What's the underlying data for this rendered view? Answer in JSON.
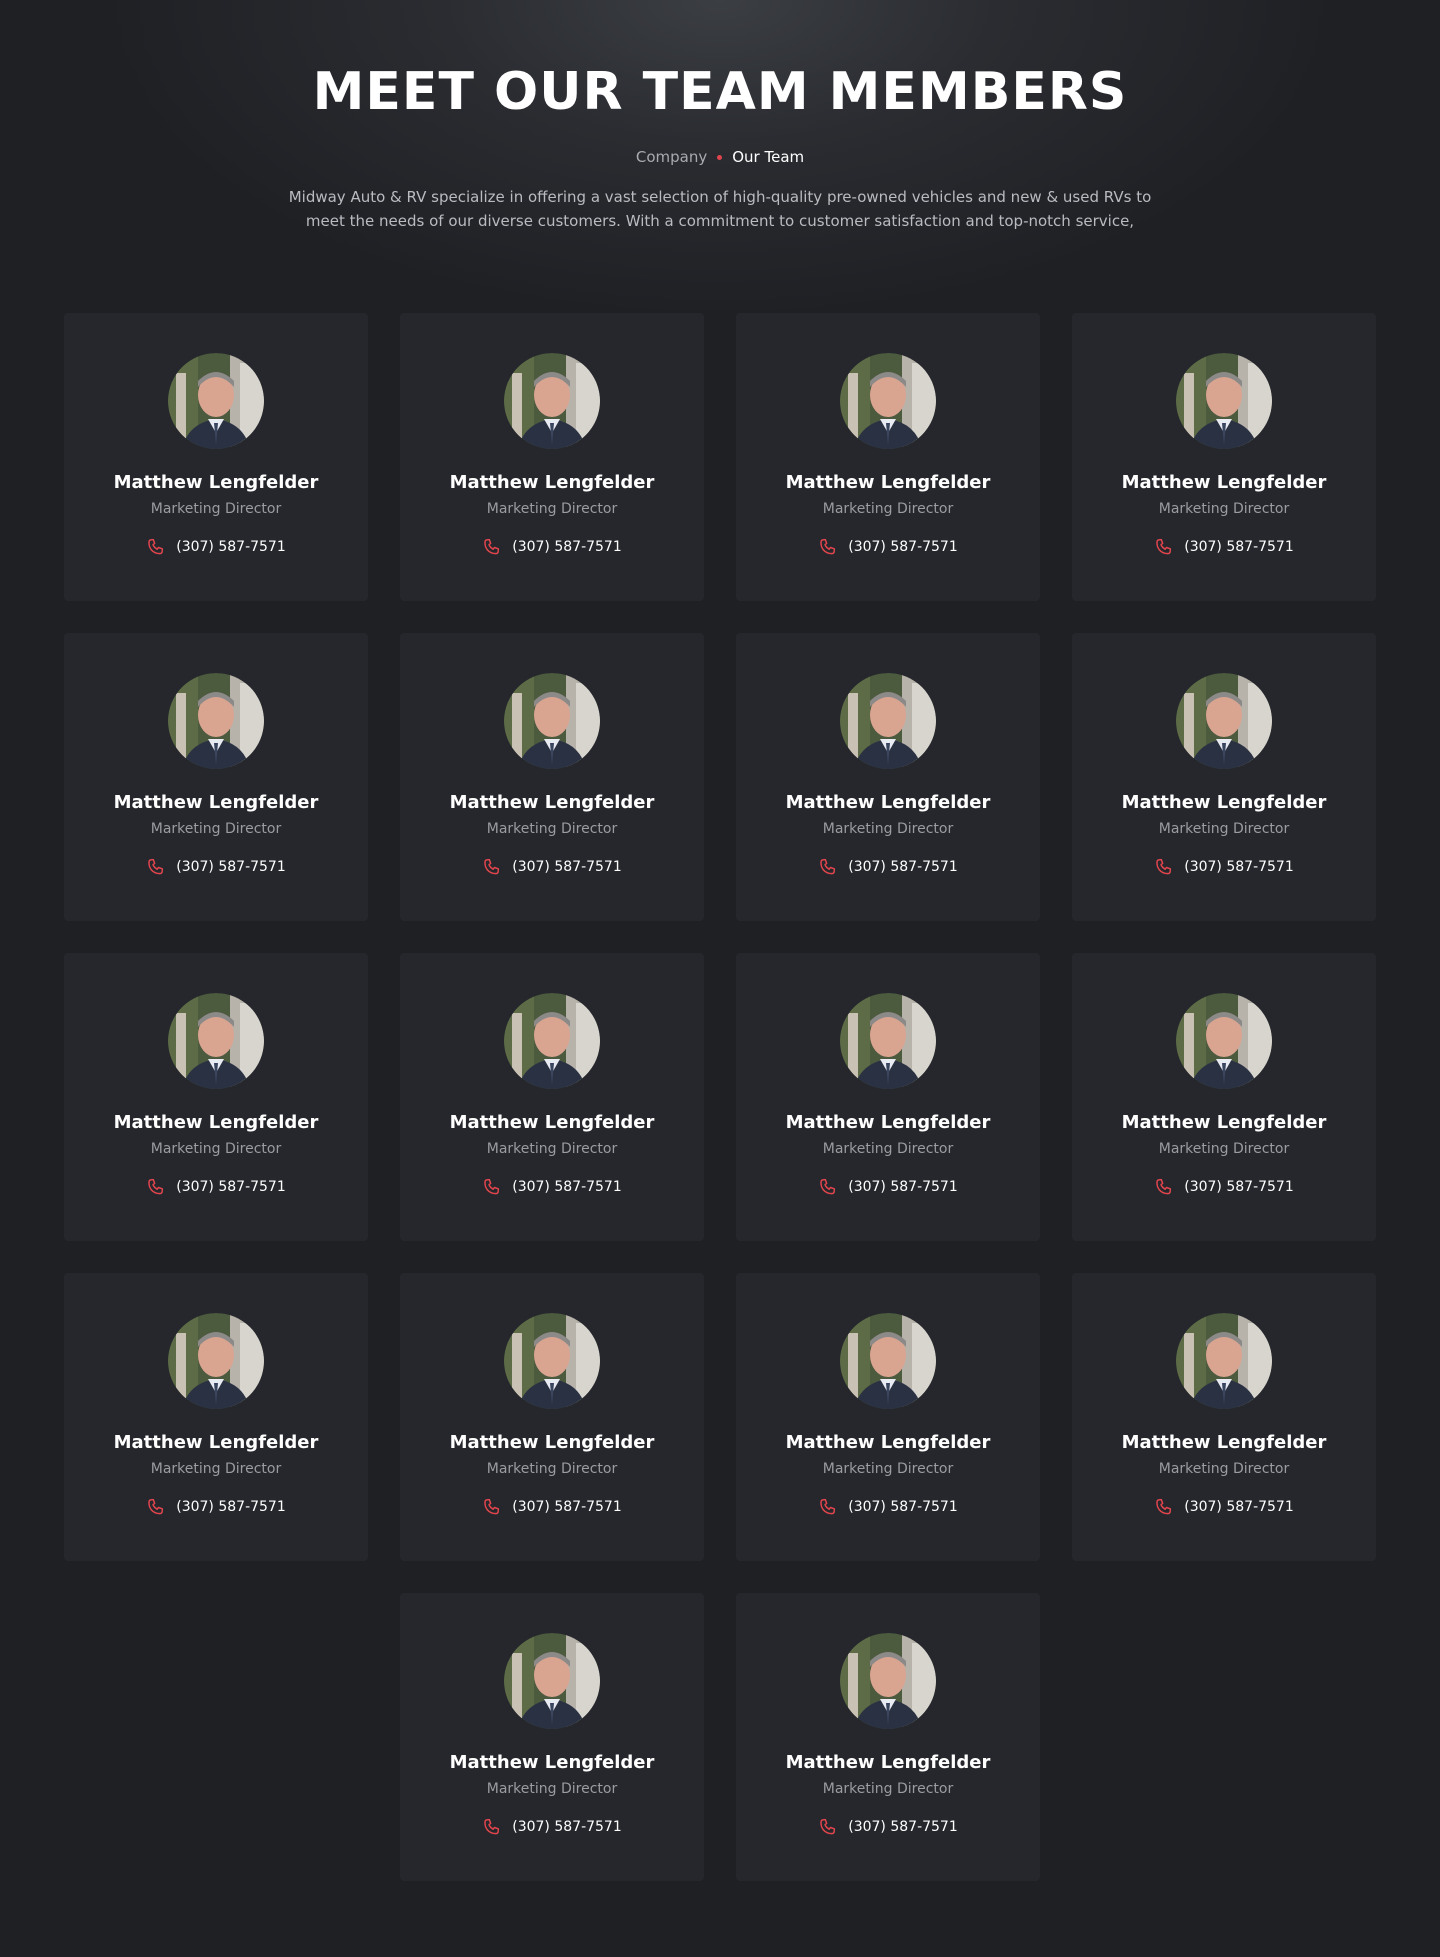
{
  "hero": {
    "title": "MEET OUR TEAM MEMBERS",
    "breadcrumb": {
      "parent": "Company",
      "current": "Our Team"
    },
    "description": "Midway Auto & RV specialize in offering a vast selection of high-quality pre-owned vehicles and new & used RVs to meet the needs of our diverse customers. With a commitment to customer satisfaction and top-notch service,"
  },
  "colors": {
    "background": "#1e2024",
    "card": "#25272c",
    "accent": "#e0454d"
  },
  "team": {
    "members": [
      {
        "name": "Matthew Lengfelder",
        "role": "Marketing Director",
        "phone": "(307) 587-7571",
        "icon": "phone-icon"
      },
      {
        "name": "Matthew Lengfelder",
        "role": "Marketing Director",
        "phone": "(307) 587-7571",
        "icon": "phone-icon"
      },
      {
        "name": "Matthew Lengfelder",
        "role": "Marketing Director",
        "phone": "(307) 587-7571",
        "icon": "phone-icon"
      },
      {
        "name": "Matthew Lengfelder",
        "role": "Marketing Director",
        "phone": "(307) 587-7571",
        "icon": "phone-icon"
      },
      {
        "name": "Matthew Lengfelder",
        "role": "Marketing Director",
        "phone": "(307) 587-7571",
        "icon": "phone-icon"
      },
      {
        "name": "Matthew Lengfelder",
        "role": "Marketing Director",
        "phone": "(307) 587-7571",
        "icon": "phone-icon"
      },
      {
        "name": "Matthew Lengfelder",
        "role": "Marketing Director",
        "phone": "(307) 587-7571",
        "icon": "phone-icon"
      },
      {
        "name": "Matthew Lengfelder",
        "role": "Marketing Director",
        "phone": "(307) 587-7571",
        "icon": "phone-icon"
      },
      {
        "name": "Matthew Lengfelder",
        "role": "Marketing Director",
        "phone": "(307) 587-7571",
        "icon": "phone-icon"
      },
      {
        "name": "Matthew Lengfelder",
        "role": "Marketing Director",
        "phone": "(307) 587-7571",
        "icon": "phone-icon"
      },
      {
        "name": "Matthew Lengfelder",
        "role": "Marketing Director",
        "phone": "(307) 587-7571",
        "icon": "phone-icon"
      },
      {
        "name": "Matthew Lengfelder",
        "role": "Marketing Director",
        "phone": "(307) 587-7571",
        "icon": "phone-icon"
      },
      {
        "name": "Matthew Lengfelder",
        "role": "Marketing Director",
        "phone": "(307) 587-7571",
        "icon": "phone-icon"
      },
      {
        "name": "Matthew Lengfelder",
        "role": "Marketing Director",
        "phone": "(307) 587-7571",
        "icon": "phone-icon"
      },
      {
        "name": "Matthew Lengfelder",
        "role": "Marketing Director",
        "phone": "(307) 587-7571",
        "icon": "phone-icon"
      },
      {
        "name": "Matthew Lengfelder",
        "role": "Marketing Director",
        "phone": "(307) 587-7571",
        "icon": "phone-icon"
      },
      {
        "name": "Matthew Lengfelder",
        "role": "Marketing Director",
        "phone": "(307) 587-7571",
        "icon": "phone-icon"
      },
      {
        "name": "Matthew Lengfelder",
        "role": "Marketing Director",
        "phone": "(307) 587-7571",
        "icon": "phone-icon"
      }
    ]
  }
}
